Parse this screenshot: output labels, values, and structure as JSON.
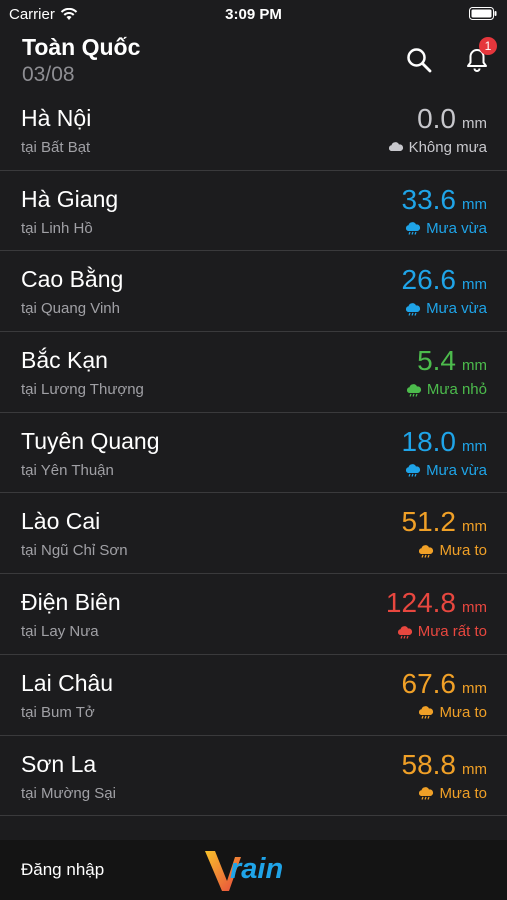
{
  "status_bar": {
    "carrier": "Carrier",
    "time": "3:09 PM"
  },
  "header": {
    "title": "Toàn Quốc",
    "date": "03/08",
    "notification_count": "1"
  },
  "unit": "mm",
  "colors": {
    "none": "#c7c7cc",
    "moderate": "#1fa4e8",
    "light": "#4cbb4c",
    "heavy": "#f0a027",
    "very_heavy": "#e8473f"
  },
  "stations": [
    {
      "name": "Hà Nội",
      "place": "tại Bất Bạt",
      "value": "0.0",
      "status": "Không mưa",
      "level": "none"
    },
    {
      "name": "Hà Giang",
      "place": "tại Linh Hồ",
      "value": "33.6",
      "status": "Mưa vừa",
      "level": "moderate"
    },
    {
      "name": "Cao Bằng",
      "place": "tại Quang Vinh",
      "value": "26.6",
      "status": "Mưa vừa",
      "level": "moderate"
    },
    {
      "name": "Bắc Kạn",
      "place": "tại Lương Thượng",
      "value": "5.4",
      "status": "Mưa nhỏ",
      "level": "light"
    },
    {
      "name": "Tuyên Quang",
      "place": "tại Yên Thuận",
      "value": "18.0",
      "status": "Mưa vừa",
      "level": "moderate"
    },
    {
      "name": "Lào Cai",
      "place": "tại Ngũ Chỉ Sơn",
      "value": "51.2",
      "status": "Mưa to",
      "level": "heavy"
    },
    {
      "name": "Điện Biên",
      "place": "tại Lay Nưa",
      "value": "124.8",
      "status": "Mưa rất to",
      "level": "very_heavy"
    },
    {
      "name": "Lai Châu",
      "place": "tại Bum Tở",
      "value": "67.6",
      "status": "Mưa to",
      "level": "heavy"
    },
    {
      "name": "Sơn La",
      "place": "tại Mường Sại",
      "value": "58.8",
      "status": "Mưa to",
      "level": "heavy"
    }
  ],
  "footer": {
    "login": "Đăng nhập",
    "logo_text": "rain"
  }
}
